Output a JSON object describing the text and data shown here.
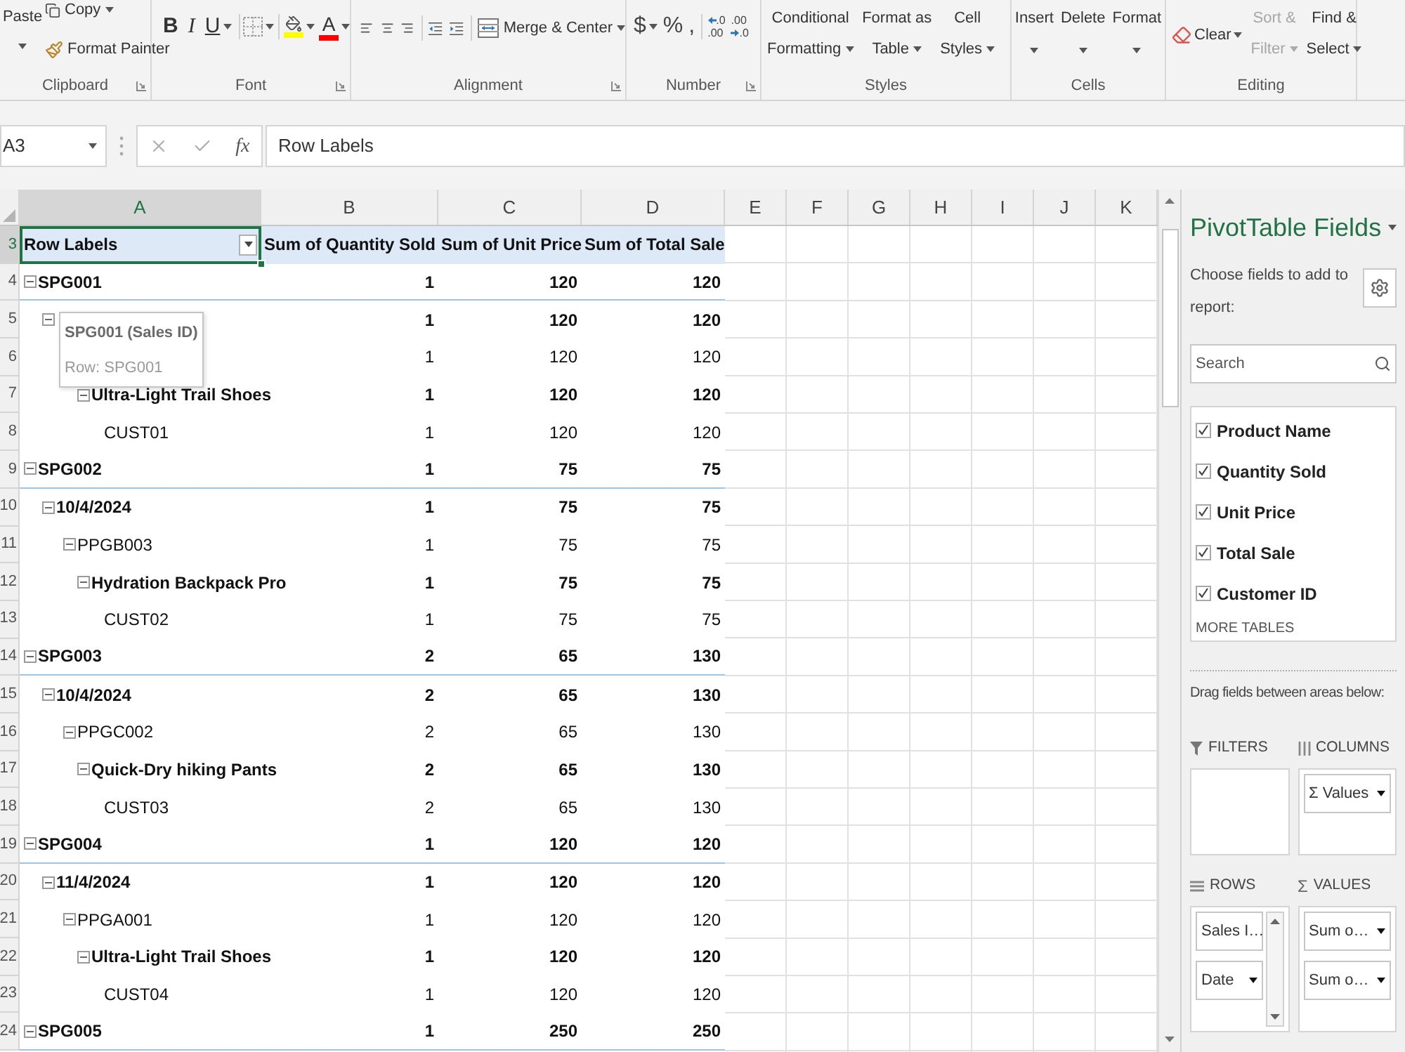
{
  "ribbon": {
    "clipboard": {
      "label": "Clipboard",
      "paste": "Paste",
      "copy": "Copy",
      "format_painter": "Format Painter"
    },
    "font": {
      "label": "Font",
      "style_buttons": [
        {
          "kind": "bold",
          "text": "B"
        },
        {
          "kind": "italic",
          "text": "I"
        },
        {
          "kind": "underline",
          "text": "U"
        }
      ],
      "fill": {
        "color": "#ffff00"
      },
      "font_color": {
        "text": "A",
        "color": "#ff0000"
      }
    },
    "alignment": {
      "label": "Alignment",
      "merge": "Merge & Center"
    },
    "number": {
      "label": "Number",
      "symbols": [
        {
          "text": "$",
          "dropdown": true
        },
        {
          "text": "%",
          "dropdown": false
        },
        {
          "text": ",",
          "dropdown": false
        }
      ],
      "decimal_buttons": [
        {
          "kind": "increase",
          "lines": [
            ".0",
            ".00"
          ]
        },
        {
          "kind": "decrease",
          "lines": [
            ".00",
            ".0"
          ]
        }
      ]
    },
    "styles": {
      "label": "Styles",
      "buttons": [
        {
          "lines": [
            "Conditional",
            "Formatting"
          ]
        },
        {
          "lines": [
            "Format as",
            "Table"
          ]
        },
        {
          "lines": [
            "Cell",
            "Styles"
          ]
        }
      ]
    },
    "cells": {
      "label": "Cells",
      "buttons": [
        "Insert",
        "Delete",
        "Format"
      ]
    },
    "editing": {
      "label": "Editing",
      "clear": "Clear",
      "buttons": [
        {
          "lines": [
            "Sort &",
            "Filter"
          ],
          "disabled": true
        },
        {
          "lines": [
            "Find &",
            "Select"
          ],
          "disabled": false
        }
      ]
    }
  },
  "formula_bar": {
    "name_box": "A3",
    "fx": "fx",
    "formula": "Row Labels"
  },
  "columns": [
    {
      "label": "A",
      "selected": true
    },
    {
      "label": "B",
      "selected": false
    },
    {
      "label": "C",
      "selected": false
    },
    {
      "label": "D",
      "selected": false
    },
    {
      "label": "E",
      "selected": false
    },
    {
      "label": "F",
      "selected": false
    },
    {
      "label": "G",
      "selected": false
    },
    {
      "label": "H",
      "selected": false
    },
    {
      "label": "I",
      "selected": false
    },
    {
      "label": "J",
      "selected": false
    },
    {
      "label": "K",
      "selected": false
    }
  ],
  "row_numbers": [
    {
      "label": "3",
      "selected": true
    },
    {
      "label": "4",
      "selected": false
    },
    {
      "label": "5",
      "selected": false
    },
    {
      "label": "6",
      "selected": false
    },
    {
      "label": "7",
      "selected": false
    },
    {
      "label": "8",
      "selected": false
    },
    {
      "label": "9",
      "selected": false
    },
    {
      "label": "10",
      "selected": false
    },
    {
      "label": "11",
      "selected": false
    },
    {
      "label": "12",
      "selected": false
    },
    {
      "label": "13",
      "selected": false
    },
    {
      "label": "14",
      "selected": false
    },
    {
      "label": "15",
      "selected": false
    },
    {
      "label": "16",
      "selected": false
    },
    {
      "label": "17",
      "selected": false
    },
    {
      "label": "18",
      "selected": false
    },
    {
      "label": "19",
      "selected": false
    },
    {
      "label": "20",
      "selected": false
    },
    {
      "label": "21",
      "selected": false
    },
    {
      "label": "22",
      "selected": false
    },
    {
      "label": "23",
      "selected": false
    },
    {
      "label": "24",
      "selected": false
    }
  ],
  "pivot": {
    "headers": [
      {
        "text": "Row Labels",
        "selected": true
      },
      {
        "text": "Sum of Quantity Sold",
        "selected": false
      },
      {
        "text": "Sum of Unit Price",
        "selected": false
      },
      {
        "text": "Sum of Total Sale",
        "selected": false
      }
    ],
    "rows": [
      {
        "label": "SPG001",
        "values": [
          "1",
          "120",
          "120"
        ],
        "expanded": true,
        "children": [
          {
            "values": [
              "1",
              "120",
              "120"
            ],
            "expanded": true,
            "children": [
              {
                "values": [
                  "1",
                  "120",
                  "120"
                ],
                "children": [
                  {
                    "label": "Ultra-Light Trail Shoes",
                    "values": [
                      "1",
                      "120",
                      "120"
                    ],
                    "expanded": true,
                    "children": [
                      {
                        "label": "CUST01",
                        "values": [
                          "1",
                          "120",
                          "120"
                        ]
                      }
                    ]
                  }
                ]
              }
            ]
          }
        ]
      },
      {
        "label": "SPG002",
        "values": [
          "1",
          "75",
          "75"
        ],
        "expanded": true,
        "children": [
          {
            "label": "10/4/2024",
            "values": [
              "1",
              "75",
              "75"
            ],
            "expanded": true,
            "children": [
              {
                "label": "PPGB003",
                "values": [
                  "1",
                  "75",
                  "75"
                ],
                "expanded": true,
                "children": [
                  {
                    "label": "Hydration Backpack Pro",
                    "values": [
                      "1",
                      "75",
                      "75"
                    ],
                    "expanded": true,
                    "children": [
                      {
                        "label": "CUST02",
                        "values": [
                          "1",
                          "75",
                          "75"
                        ]
                      }
                    ]
                  }
                ]
              }
            ]
          }
        ]
      },
      {
        "label": "SPG003",
        "values": [
          "2",
          "65",
          "130"
        ],
        "expanded": true,
        "children": [
          {
            "label": "10/4/2024",
            "values": [
              "2",
              "65",
              "130"
            ],
            "expanded": true,
            "children": [
              {
                "label": "PPGC002",
                "values": [
                  "2",
                  "65",
                  "130"
                ],
                "expanded": true,
                "children": [
                  {
                    "label": "Quick-Dry hiking Pants",
                    "values": [
                      "2",
                      "65",
                      "130"
                    ],
                    "expanded": true,
                    "children": [
                      {
                        "label": "CUST03",
                        "values": [
                          "2",
                          "65",
                          "130"
                        ]
                      }
                    ]
                  }
                ]
              }
            ]
          }
        ]
      },
      {
        "label": "SPG004",
        "values": [
          "1",
          "120",
          "120"
        ],
        "expanded": true,
        "children": [
          {
            "label": "11/4/2024",
            "values": [
              "1",
              "120",
              "120"
            ],
            "expanded": true,
            "children": [
              {
                "label": "PPGA001",
                "values": [
                  "1",
                  "120",
                  "120"
                ],
                "expanded": true,
                "children": [
                  {
                    "label": "Ultra-Light Trail Shoes",
                    "values": [
                      "1",
                      "120",
                      "120"
                    ],
                    "expanded": true,
                    "children": [
                      {
                        "label": "CUST04",
                        "values": [
                          "1",
                          "120",
                          "120"
                        ]
                      }
                    ]
                  }
                ]
              }
            ]
          }
        ]
      },
      {
        "label": "SPG005",
        "values": [
          "1",
          "250",
          "250"
        ],
        "expanded": true
      }
    ]
  },
  "tooltip": {
    "title": "SPG001 (Sales ID)",
    "detail": "Row: SPG001"
  },
  "field_list": {
    "title": "PivotTable Fields",
    "instructions": "Choose fields to add to report:",
    "search_placeholder": "Search",
    "fields": [
      {
        "label": "Product Name",
        "checked": true
      },
      {
        "label": "Quantity Sold",
        "checked": true
      },
      {
        "label": "Unit Price",
        "checked": true
      },
      {
        "label": "Total Sale",
        "checked": true
      },
      {
        "label": "Customer ID",
        "checked": true
      }
    ],
    "more_tables": "MORE TABLES",
    "drag_hint": "Drag fields between areas below:",
    "areas": [
      {
        "kind": "filters",
        "label": "FILTERS"
      },
      {
        "kind": "columns",
        "label": "COLUMNS",
        "items": [
          "Σ Values"
        ]
      },
      {
        "kind": "rows",
        "label": "ROWS",
        "items": [
          "Sales I…",
          "Date"
        ]
      },
      {
        "kind": "values",
        "label": "VALUES",
        "symbol": "Σ",
        "items": [
          "Sum o…",
          "Sum o…"
        ]
      }
    ]
  }
}
